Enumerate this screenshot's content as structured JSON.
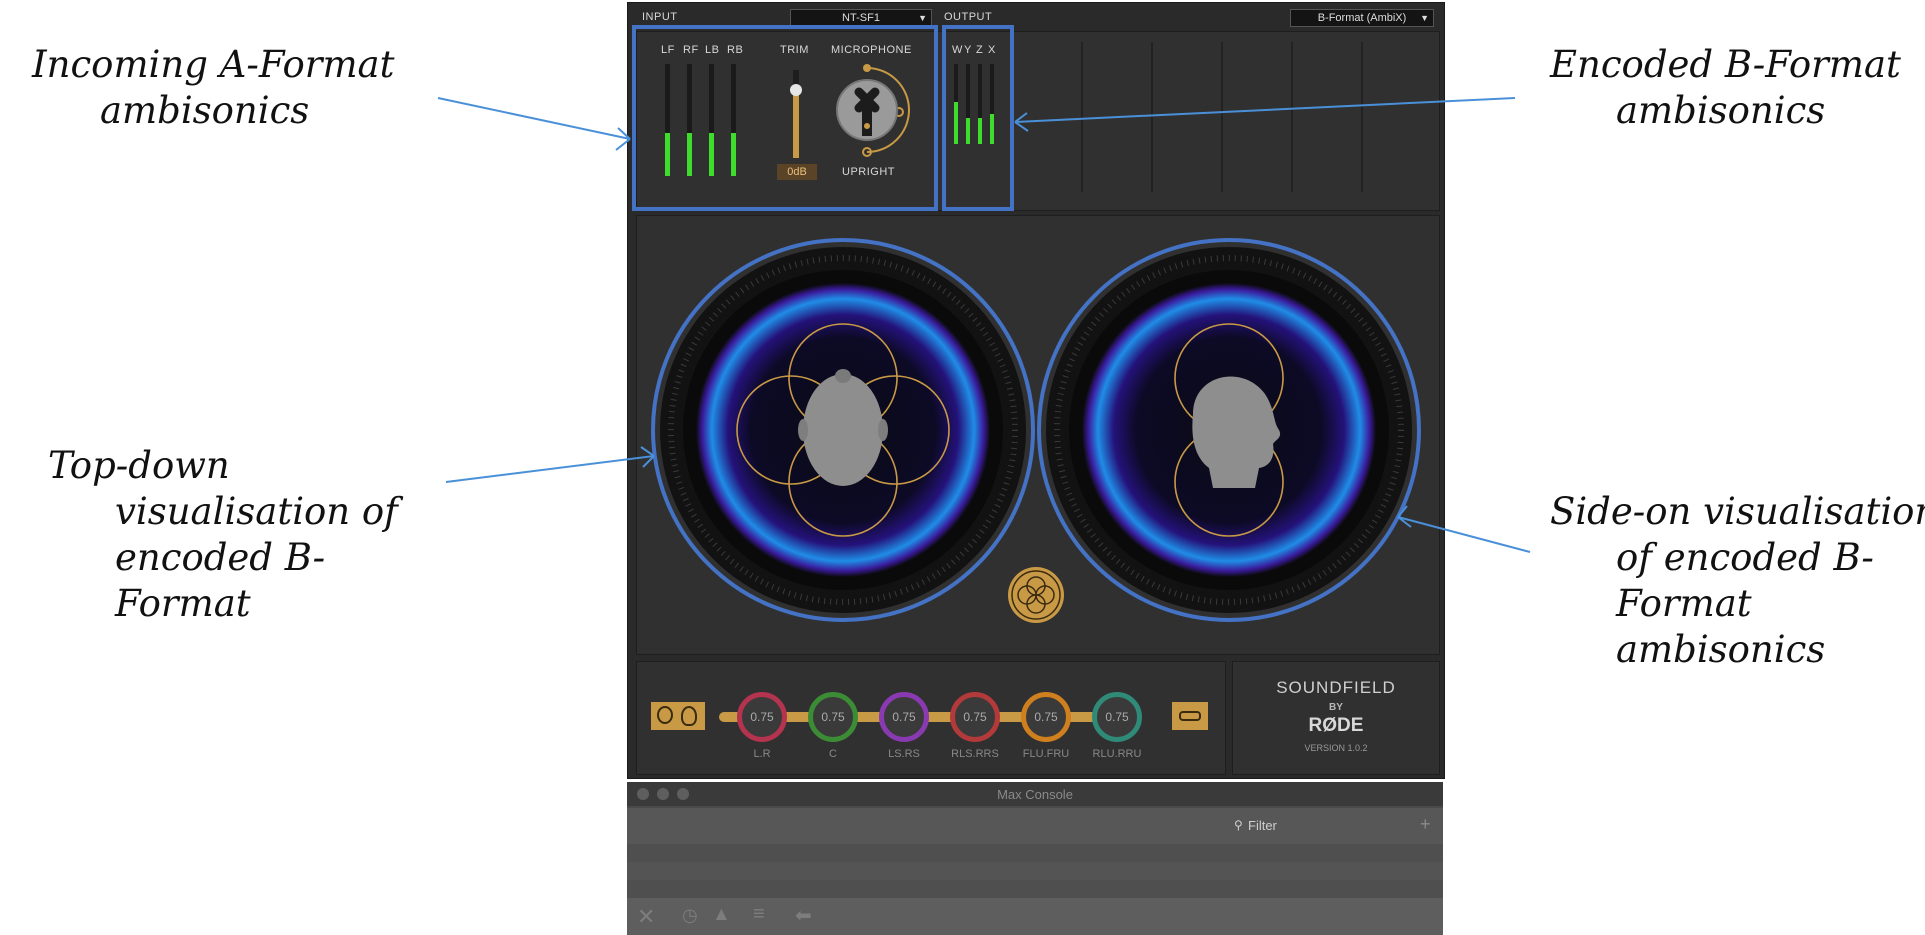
{
  "annotations": {
    "a_format": [
      "Incoming A-Format",
      "ambisonics"
    ],
    "b_format": [
      "Encoded B-Format",
      "ambisonics"
    ],
    "top_down": [
      "Top-down",
      "visualisation of",
      "encoded B-",
      "Format"
    ],
    "side_on": [
      "Side-on visualisation",
      "of encoded B-",
      "Format",
      "ambisonics"
    ]
  },
  "header": {
    "input_label": "INPUT",
    "input_select": "NT-SF1",
    "output_label": "OUTPUT",
    "output_select": "B-Format (AmbiX)"
  },
  "input_panel": {
    "channels": [
      {
        "label": "LF",
        "level": 0.38
      },
      {
        "label": "RF",
        "level": 0.38
      },
      {
        "label": "LB",
        "level": 0.38
      },
      {
        "label": "RB",
        "level": 0.38
      }
    ],
    "trim_label": "TRIM",
    "trim_value": "0dB",
    "microphone_label": "MICROPHONE",
    "orientation": "UPRIGHT"
  },
  "output_panel": {
    "channels": [
      {
        "label": "W",
        "level": 0.52
      },
      {
        "label": "Y",
        "level": 0.32
      },
      {
        "label": "Z",
        "level": 0.32
      },
      {
        "label": "X",
        "level": 0.38
      }
    ]
  },
  "knobs": [
    {
      "value": "0.75",
      "label": "L.R",
      "color": "#b4334e"
    },
    {
      "value": "0.75",
      "label": "C",
      "color": "#3c8c36"
    },
    {
      "value": "0.75",
      "label": "LS.RS",
      "color": "#8a3ab0"
    },
    {
      "value": "0.75",
      "label": "RLS.RRS",
      "color": "#b33a3a"
    },
    {
      "value": "0.75",
      "label": "FLU.FRU",
      "color": "#d07f1e"
    },
    {
      "value": "0.75",
      "label": "RLU.RRU",
      "color": "#2f8a78"
    }
  ],
  "brand": {
    "name": "SOUNDFIELD",
    "by": "BY",
    "maker": "RØDE",
    "version": "VERSION 1.0.2"
  },
  "console": {
    "title": "Max Console",
    "filter_placeholder": "Filter"
  },
  "colors": {
    "highlight": "#4472c4",
    "meter_green": "#3ddc2d",
    "gold": "#d2a24c",
    "panel": "#2a2a2a"
  },
  "icons": {
    "console_toolbar": [
      "close-icon",
      "clock-icon",
      "warning-icon",
      "levels-icon",
      "back-arrow-icon"
    ]
  }
}
